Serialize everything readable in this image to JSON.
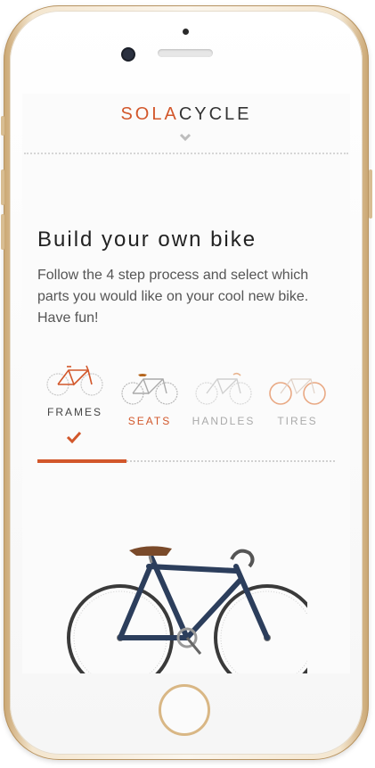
{
  "app": {
    "logo_part1": "SOLA",
    "logo_part2": "CYCLE",
    "accent_color": "#d2572b"
  },
  "main": {
    "title": "Build your own bike",
    "description": "Follow the 4 step process and select which parts you would like on your cool new bike. Have fun!"
  },
  "steps": [
    {
      "label": "FRAMES",
      "state": "completed",
      "icon": "bike-frame-icon",
      "color": "#444444"
    },
    {
      "label": "SEATS",
      "state": "active",
      "icon": "bike-seat-icon",
      "color": "#d2572b"
    },
    {
      "label": "HANDLES",
      "state": "upcoming",
      "icon": "bike-handles-icon",
      "color": "#aaaaaa"
    },
    {
      "label": "TIRES",
      "state": "upcoming",
      "icon": "bike-tires-icon",
      "color": "#aaaaaa"
    }
  ],
  "progress": {
    "fraction": 0.3
  },
  "preview": {
    "icon": "bike-photo",
    "frame_color": "#2c3e5c"
  }
}
